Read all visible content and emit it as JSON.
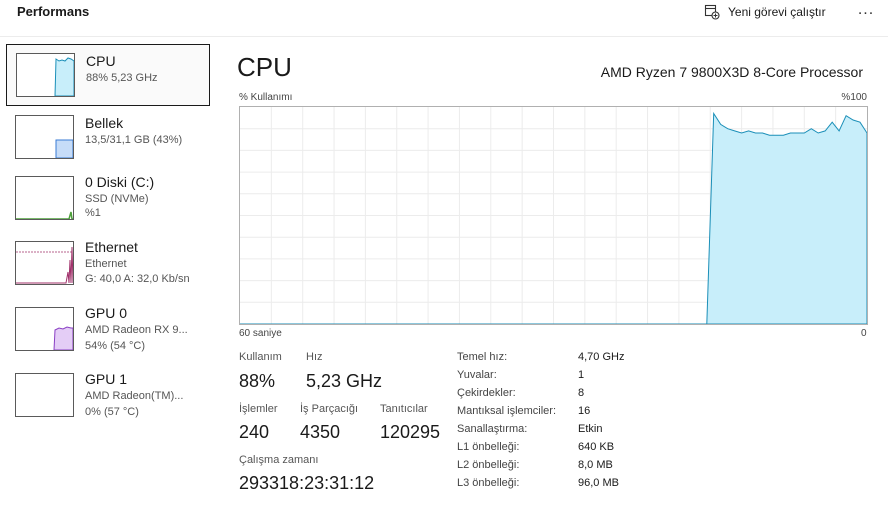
{
  "header": {
    "title": "Performans",
    "new_task_label": "Yeni görevi çalıştır",
    "more_label": "..."
  },
  "sidebar": {
    "items": [
      {
        "name": "CPU",
        "line1": "88%  5,23 GHz",
        "line2": "",
        "line3": ""
      },
      {
        "name": "Bellek",
        "line1": "13,5/31,1 GB (43%)",
        "line2": "",
        "line3": ""
      },
      {
        "name": "0 Diski (C:)",
        "line1": "SSD (NVMe)",
        "line2": "%1",
        "line3": ""
      },
      {
        "name": "Ethernet",
        "line1": "Ethernet",
        "line2": "G: 40,0  A: 32,0 Kb/sn",
        "line3": ""
      },
      {
        "name": "GPU 0",
        "line1": "AMD Radeon RX 9...",
        "line2": "54%  (54 °C)",
        "line3": ""
      },
      {
        "name": "GPU 1",
        "line1": "AMD Radeon(TM)...",
        "line2": "0%  (57 °C)",
        "line3": ""
      }
    ]
  },
  "main": {
    "title": "CPU",
    "model": "AMD Ryzen 7 9800X3D 8-Core Processor",
    "y_label": "% Kullanımı",
    "y_max_label": "%100",
    "x_left_label": "60 saniye",
    "x_right_label": "0",
    "stats": {
      "usage_label": "Kullanım",
      "usage_value": "88%",
      "speed_label": "Hız",
      "speed_value": "5,23 GHz",
      "processes_label": "İşlemler",
      "processes_value": "240",
      "threads_label": "İş Parçacığı",
      "threads_value": "4350",
      "handles_label": "Tanıtıcılar",
      "handles_value": "120295",
      "uptime_label": "Çalışma zamanı",
      "uptime_value": "293318:23:31:12"
    },
    "details": [
      {
        "key": "Temel hız:",
        "value": "4,70 GHz"
      },
      {
        "key": "Yuvalar:",
        "value": "1"
      },
      {
        "key": "Çekirdekler:",
        "value": "8"
      },
      {
        "key": "Mantıksal işlemciler:",
        "value": "16"
      },
      {
        "key": "Sanallaştırma:",
        "value": "Etkin"
      },
      {
        "key": "L1 önbelleği:",
        "value": "640 KB"
      },
      {
        "key": "L2 önbelleği:",
        "value": "8,0 MB"
      },
      {
        "key": "L3 önbelleği:",
        "value": "96,0 MB"
      }
    ]
  },
  "colors": {
    "cpu_line": "#1b8fb8",
    "cpu_fill": "#c8eefa",
    "mem_line": "#3a7bd5",
    "mem_fill": "#c6dcf8",
    "disk_line": "#4da03a",
    "eth_line": "#a0306a",
    "gpu_line": "#8a3fc4",
    "gpu_fill": "#e4cdf6",
    "grid": "#ececec"
  },
  "cpu_history_percent": [
    0,
    0,
    0,
    0,
    0,
    0,
    0,
    0,
    0,
    0,
    0,
    0,
    0,
    0,
    0,
    0,
    0,
    0,
    0,
    0,
    0,
    0,
    0,
    0,
    0,
    0,
    0,
    0,
    0,
    0,
    0,
    0,
    0,
    0,
    0,
    0,
    0,
    0,
    0,
    0,
    0,
    0,
    0,
    0,
    0,
    0,
    0,
    0,
    0,
    0,
    0,
    0,
    0,
    0,
    0,
    0,
    0,
    0,
    0,
    0,
    0,
    0,
    0,
    0,
    0,
    0,
    0,
    0,
    97,
    92,
    90,
    89,
    88,
    89,
    88,
    88,
    87,
    87,
    87,
    88,
    88,
    88,
    90,
    88,
    89,
    93,
    89,
    96,
    94,
    93,
    88
  ]
}
